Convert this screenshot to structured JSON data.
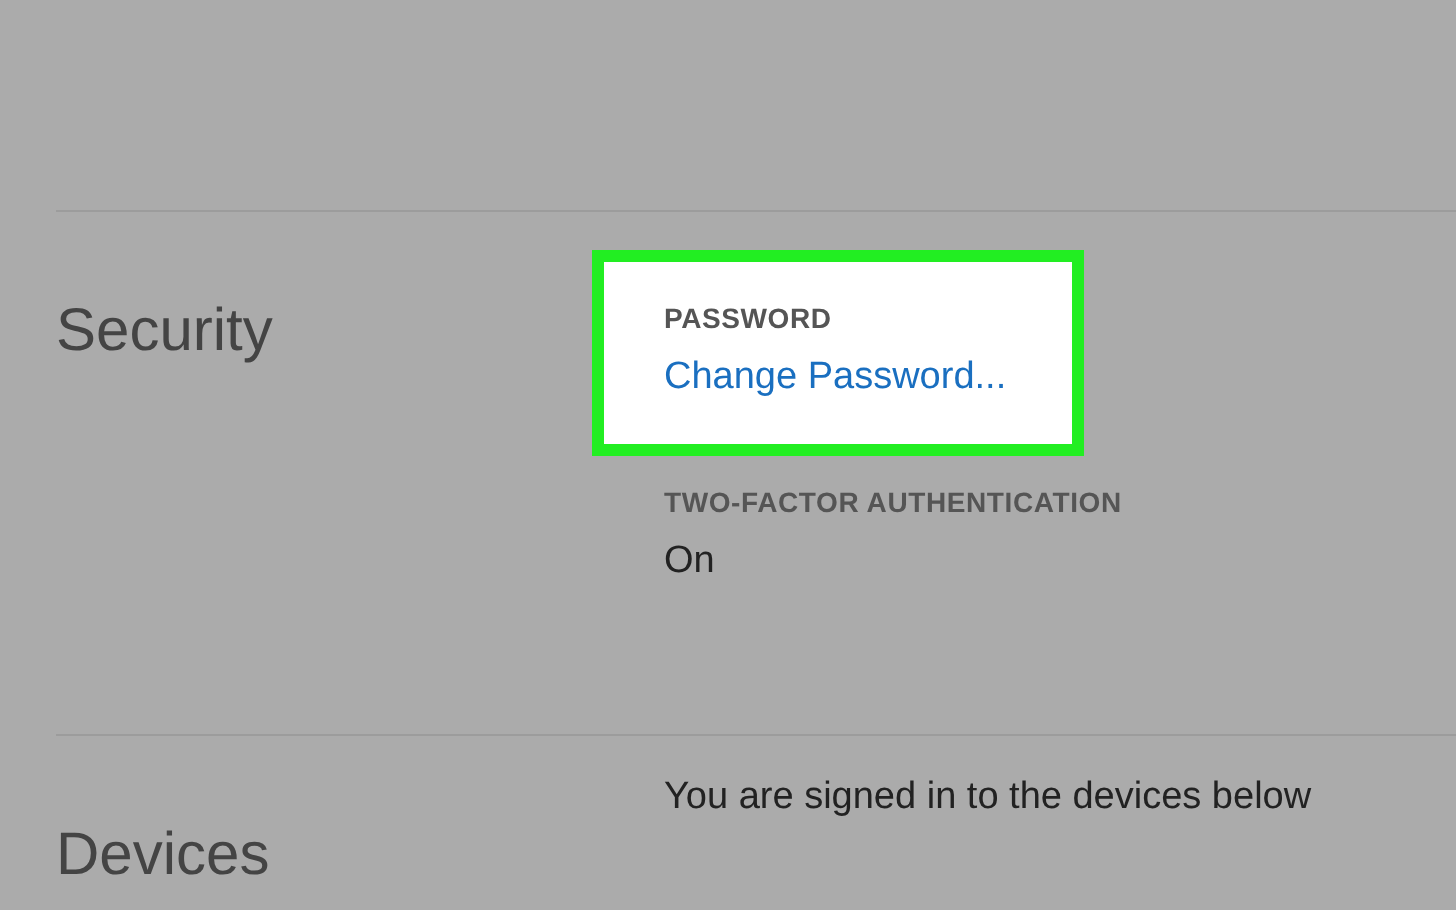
{
  "sections": [
    {
      "heading": "Security",
      "fields": [
        {
          "label": "PASSWORD",
          "value": "Change Password...",
          "kind": "link",
          "highlighted": true
        },
        {
          "label": "TWO-FACTOR AUTHENTICATION",
          "value": "On",
          "kind": "text",
          "highlighted": false
        }
      ]
    },
    {
      "heading": "Devices",
      "fields": [
        {
          "value": "You are signed in to the devices below",
          "kind": "text",
          "highlighted": false
        }
      ]
    }
  ]
}
